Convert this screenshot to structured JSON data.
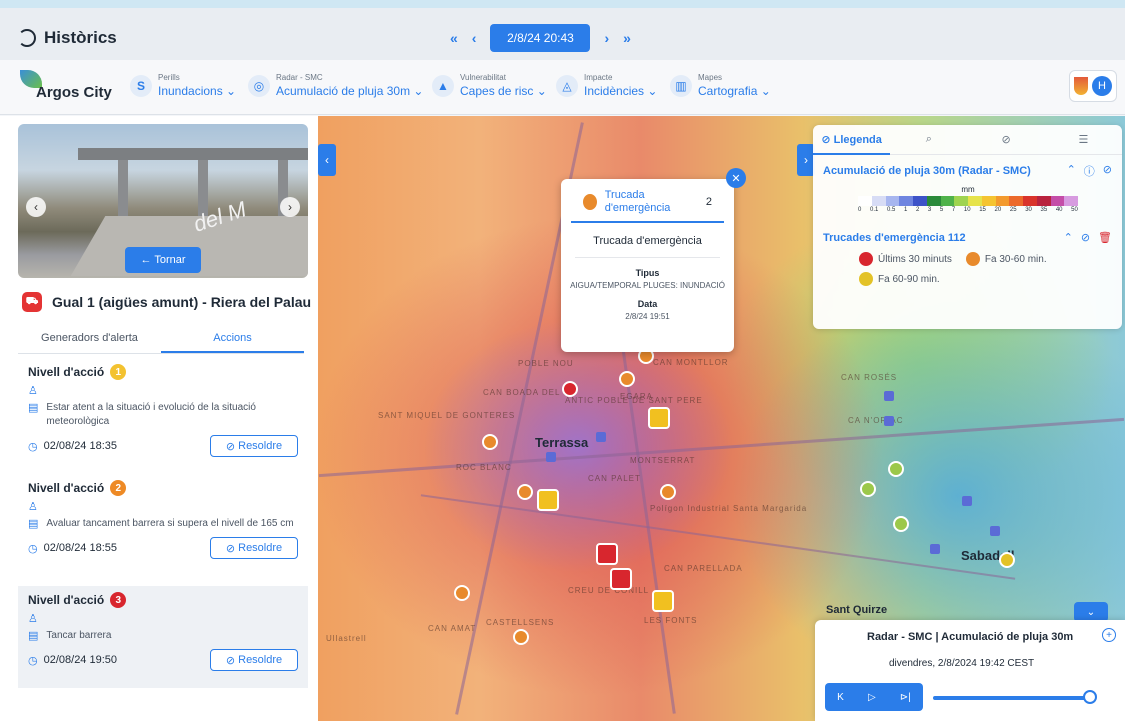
{
  "header": {
    "title": "Històrics",
    "nav_first": "«",
    "nav_prev": "‹",
    "current_datetime": "2/8/24 20:43",
    "nav_next": "›",
    "nav_last": "»"
  },
  "toolbar": {
    "logo_text": "Argos City",
    "groups": [
      {
        "label": "Perills",
        "value": "Inundacions ⌄",
        "icon": "S"
      },
      {
        "label": "Radar - SMC",
        "value": "Acumulació de pluja 30m ⌄",
        "icon": "◎"
      },
      {
        "label": "Vulnerabilitat",
        "value": "Capes de risc ⌄",
        "icon": "▲"
      },
      {
        "label": "Impacte",
        "value": "Incidències ⌄",
        "icon": "◬"
      },
      {
        "label": "Mapes",
        "value": "Cartografia ⌄",
        "icon": "▥"
      }
    ],
    "user_initial": "H"
  },
  "left_panel": {
    "photo_sign": "del M",
    "back_label": "← Tornar",
    "title": "Gual 1 (aigües amunt) - Riera del Palau",
    "tabs": [
      "Generadors d'alerta",
      "Accions"
    ],
    "actions": [
      {
        "level_label": "Nivell d'acció",
        "level": "1",
        "color": "#f3c230",
        "text": "Estar atent a la situació i evolució de la situació meteorològica",
        "date": "02/08/24 18:35",
        "button": "Resoldre"
      },
      {
        "level_label": "Nivell d'acció",
        "level": "2",
        "color": "#ee8a25",
        "text": "Avaluar tancament barrera si supera el nivell de 165 cm",
        "date": "02/08/24 18:55",
        "button": "Resoldre"
      },
      {
        "level_label": "Nivell d'acció",
        "level": "3",
        "color": "#d8262e",
        "text": "Tancar barrera",
        "date": "02/08/24 19:50",
        "button": "Resoldre"
      }
    ]
  },
  "map": {
    "labels": {
      "city1": "Terrassa",
      "city2": "Sabadell",
      "city3": "Sant Quirze",
      "area1": "POBLE NOU",
      "area2": "CAN BOADA DEL PI",
      "area3": "ANTIC POBLE DE SANT PERE",
      "area4": "SANT MIQUEL DE GONTERES",
      "area5": "CAN PALET",
      "area6": "MONTSERRAT",
      "area7": "CAN AMAT",
      "area8": "CASTELLSENS",
      "area9": "LES FONTS",
      "area10": "CAN PARELLADA",
      "area11": "EGARA",
      "area12": "CA N'ORIAC",
      "area13": "Ullastrell",
      "area14": "CAN MONTLLOR",
      "area15": "CREU DE CONILL",
      "area16": "ROC BLANC",
      "area17": "CAN ROSÉS",
      "area18": "Polígon Industrial Santa Margarida"
    },
    "popup": {
      "title": "Trucada d'emergència",
      "count": "2",
      "subtitle": "Trucada d'emergència",
      "type_label": "Tipus",
      "type_value": "AIGUA/TEMPORAL PLUGES: INUNDACIÓ",
      "date_label": "Data",
      "date_value": "2/8/24 19:51",
      "close": "✕"
    },
    "legend": {
      "tab_legend": "Llegenda",
      "tab_search": "⌕",
      "tab_compass": "⊘",
      "tab_settings": "☰",
      "section1": "Acumulació de pluja 30m (Radar - SMC)",
      "unit": "mm",
      "ticks": [
        "0",
        "0.1",
        "0.5",
        "1",
        "2",
        "3",
        "5",
        "7",
        "10",
        "15",
        "20",
        "25",
        "30",
        "35",
        "40",
        "50"
      ],
      "scale_colors": [
        "#ffffff",
        "#d7dcf5",
        "#a7b6ef",
        "#6f85e0",
        "#3d53c8",
        "#2a8a3a",
        "#4fb24a",
        "#9fd450",
        "#e6e34a",
        "#f5c431",
        "#f39a2d",
        "#ec6a2b",
        "#d9342b",
        "#b8233e",
        "#c44da8",
        "#d79be0"
      ],
      "section2": "Trucades d'emergència 112",
      "items": [
        {
          "label": "Últims 30 minuts",
          "color": "#d8262e"
        },
        {
          "label": "Fa 30-60 min.",
          "color": "#e88a2c"
        },
        {
          "label": "Fa 60-90 min.",
          "color": "#e3c227"
        }
      ]
    },
    "radar": {
      "title": "Radar - SMC | Acumulació de pluja 30m",
      "datetime": "divendres, 2/8/2024 19:42 CEST",
      "ctrl_prev": "K",
      "ctrl_play": "▷",
      "ctrl_next": "⊳|"
    }
  }
}
